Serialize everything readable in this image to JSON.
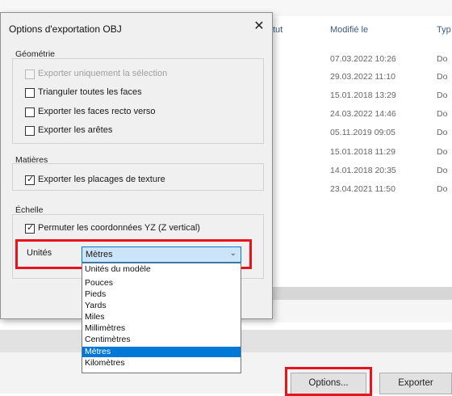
{
  "file_list": {
    "columns": {
      "status_partial": "tut",
      "modified": "Modifié le",
      "type_partial": "Typ"
    },
    "rows": [
      {
        "modified": "07.03.2022 10:26",
        "type": "Do"
      },
      {
        "modified": "29.03.2022 11:10",
        "type": "Do"
      },
      {
        "modified": "15.01.2018 13:29",
        "type": "Do"
      },
      {
        "modified": "24.03.2022 14:46",
        "type": "Do"
      },
      {
        "modified": "05.11.2019 09:05",
        "type": "Do"
      },
      {
        "modified": "15.01.2018 11:29",
        "type": "Do"
      },
      {
        "modified": "14.01.2018 20:35",
        "type": "Do"
      },
      {
        "modified": "23.04.2021 11:50",
        "type": "Do"
      }
    ]
  },
  "footer": {
    "options_label": "Options...",
    "export_label": "Exporter",
    "hidden_button_partial": "er"
  },
  "dialog": {
    "title": "Options d'exportation OBJ",
    "close_glyph": "✕",
    "geometry": {
      "label": "Géométrie",
      "options": [
        {
          "label": "Exporter uniquement la sélection",
          "checked": false,
          "disabled": true
        },
        {
          "label": "Trianguler toutes les faces",
          "checked": false,
          "disabled": false
        },
        {
          "label": "Exporter les faces recto verso",
          "checked": false,
          "disabled": false
        },
        {
          "label": "Exporter les arêtes",
          "checked": false,
          "disabled": false
        }
      ]
    },
    "materials": {
      "label": "Matières",
      "options": [
        {
          "label": "Exporter les placages de texture",
          "checked": true
        }
      ]
    },
    "scale": {
      "label": "Échelle",
      "options": [
        {
          "label": "Permuter les coordonnées YZ (Z vertical)",
          "checked": true
        }
      ],
      "units_label": "Unités",
      "selected_unit": "Mètres",
      "unit_options": [
        "Unités du modèle",
        "Pouces",
        "Pieds",
        "Yards",
        "Miles",
        "Millimètres",
        "Centimètres",
        "Mètres",
        "Kilomètres"
      ],
      "selected_index": 7
    }
  },
  "colors": {
    "highlight_red": "#e8141c",
    "selection_blue": "#0078d7"
  },
  "icons": {
    "close": "close-icon",
    "check": "check-icon",
    "dropdown": "chevron-down-icon"
  }
}
